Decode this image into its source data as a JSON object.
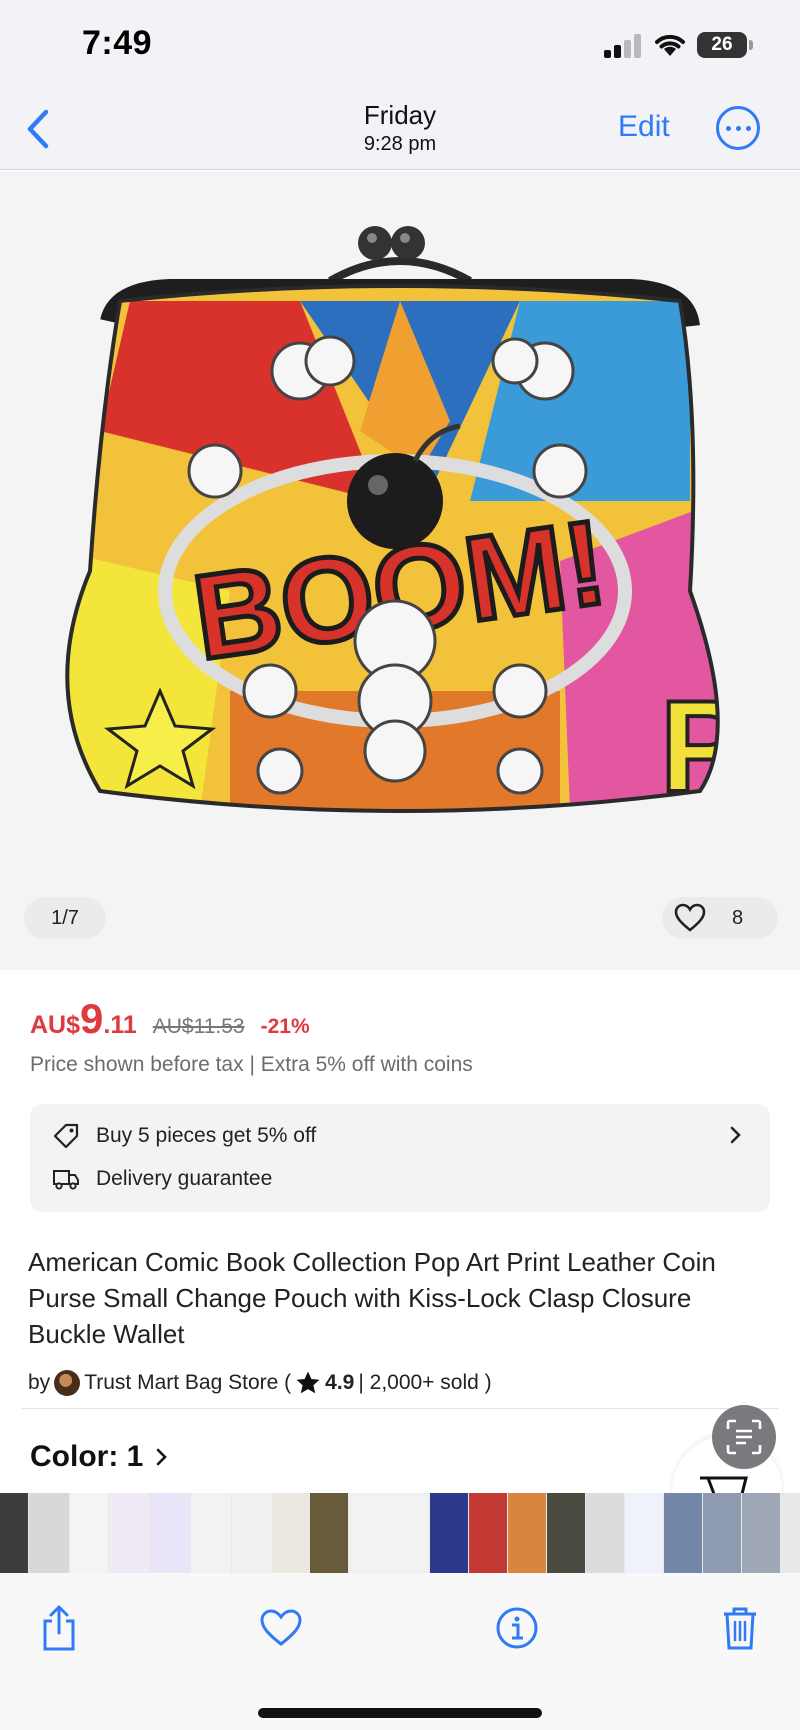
{
  "status_bar": {
    "time": "7:49",
    "battery": "26"
  },
  "nav": {
    "title": "Friday",
    "subtitle": "9:28 pm",
    "edit_label": "Edit"
  },
  "gallery": {
    "counter": "1/7",
    "like_count": "8"
  },
  "product": {
    "currency": "AU$",
    "price_int": "9",
    "price_dec": ".11",
    "old_price": "AU$11.53",
    "discount": "-21%",
    "price_note": "Price shown before tax | Extra 5% off with coins",
    "promo_text": "Buy 5 pieces get 5% off",
    "delivery_text": "Delivery guarantee",
    "title": "American Comic Book Collection Pop Art Print Leather Coin Purse Small Change Pouch with Kiss-Lock Clasp Closure Buckle Wallet",
    "seller_prefix": "by",
    "seller_name": "Trust Mart Bag Store (",
    "rating": "4.9",
    "sold": "| 2,000+ sold )",
    "color_label": "Color: 1"
  },
  "colors": {
    "accent": "#2f7bf5",
    "price_red": "#e0393e"
  }
}
